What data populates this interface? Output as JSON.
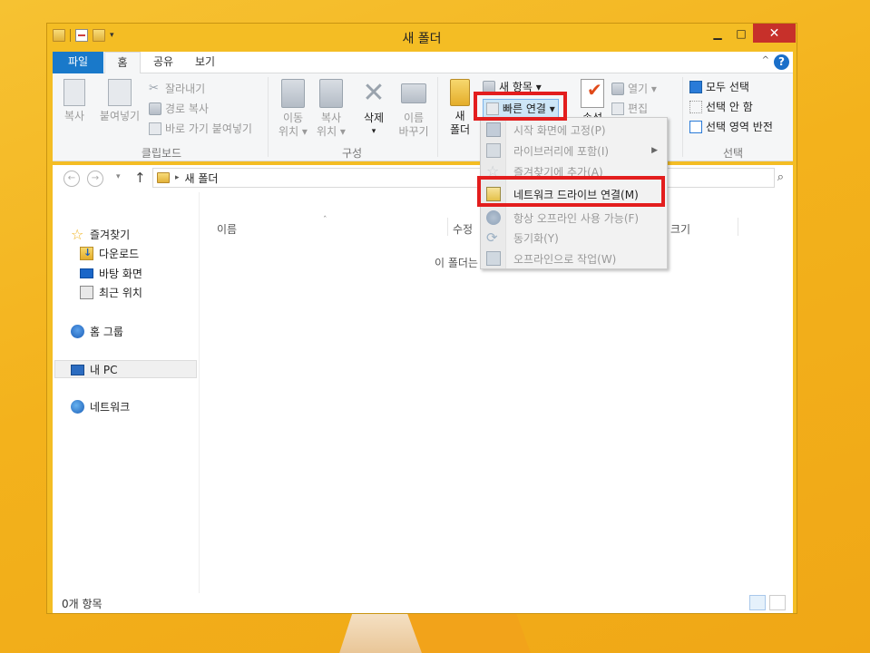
{
  "window": {
    "title": "새 폴더",
    "min_glyph": "▁",
    "max_glyph": "□",
    "close_glyph": "✕"
  },
  "qat": {
    "dropdown_glyph": "▾"
  },
  "tabs": {
    "file": "파일",
    "home": "홈",
    "share": "공유",
    "view": "보기",
    "collapse_glyph": "^",
    "help_glyph": "?"
  },
  "ribbon": {
    "clipboard": {
      "copy": "복사",
      "paste": "붙여넣기",
      "cut": "잘라내기",
      "copy_path": "경로 복사",
      "paste_shortcut": "바로 가기 붙여넣기",
      "label": "클립보드"
    },
    "organize": {
      "move_to_line1": "이동",
      "move_to_line2": "위치 ▾",
      "copy_to_line1": "복사",
      "copy_to_line2": "위치 ▾",
      "delete": "삭제",
      "delete_arrow": "▾",
      "rename_line1": "이름",
      "rename_line2": "바꾸기",
      "label": "구성"
    },
    "new": {
      "new_folder_line1": "새",
      "new_folder_line2": "폴더",
      "new_item": "새 항목 ▾",
      "easy_access": "빠른 연결 ▾",
      "label_partial": "새"
    },
    "open": {
      "properties_partial": "속성",
      "open": "열기 ▾",
      "edit": "편집"
    },
    "select": {
      "select_all": "모두 선택",
      "select_none": "선택 안 함",
      "invert": "선택 영역 반전",
      "label": "선택"
    }
  },
  "address": {
    "back": "←",
    "forward": "→",
    "dropdown": "▾",
    "up": "↑",
    "chevron": "▸",
    "path": "새 폴더",
    "search_glyph": "⌕"
  },
  "nav": {
    "favorites": "즐겨찾기",
    "downloads": "다운로드",
    "desktop": "바탕 화면",
    "recent": "최근 위치",
    "homegroup": "홈 그룹",
    "this_pc": "내 PC",
    "network": "네트워크",
    "star_glyph": "☆"
  },
  "files": {
    "col_name": "이름",
    "col_modified": "수정",
    "col_size": "크기",
    "sort_glyph": "ˆ",
    "empty_message": "이 폴더는"
  },
  "status": {
    "count": "0개 항목"
  },
  "menu": {
    "items": [
      {
        "label": "시작 화면에 고정(P)",
        "enabled": false
      },
      {
        "label": "라이브러리에 포함(I)",
        "enabled": false,
        "submenu_glyph": "▶"
      },
      {
        "label": "즐겨찾기에 추가(A)",
        "enabled": false
      },
      {
        "label": "네트워크 드라이브 연결(M)",
        "enabled": true
      },
      {
        "label": "항상 오프라인 사용 가능(F)",
        "enabled": false
      },
      {
        "label": "동기화(Y)",
        "enabled": false
      },
      {
        "label": "오프라인으로 작업(W)",
        "enabled": false
      }
    ],
    "star_glyph": "☆",
    "sync_glyph": "⟳"
  },
  "colors": {
    "desktop": "#f3b21c",
    "file_tab": "#1979ca",
    "close_button": "#c7302a",
    "highlight": "#e31d1d"
  }
}
